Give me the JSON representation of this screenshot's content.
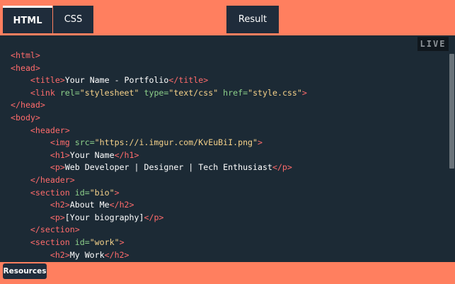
{
  "tabs": {
    "html": "HTML",
    "css": "CSS",
    "result": "Result"
  },
  "editor": {
    "live_badge": "LIVE",
    "lines": [
      [
        {
          "t": "tag",
          "v": "<html>"
        }
      ],
      [
        {
          "t": "tag",
          "v": "<head>"
        }
      ],
      [
        {
          "t": "txt",
          "v": "    "
        },
        {
          "t": "tag",
          "v": "<title>"
        },
        {
          "t": "txt",
          "v": "Your Name - Portfolio"
        },
        {
          "t": "tag",
          "v": "</title>"
        }
      ],
      [
        {
          "t": "txt",
          "v": "    "
        },
        {
          "t": "tag",
          "v": "<link "
        },
        {
          "t": "attr",
          "v": "rel="
        },
        {
          "t": "str",
          "v": "\"stylesheet\""
        },
        {
          "t": "attr",
          "v": " type="
        },
        {
          "t": "str",
          "v": "\"text/css\""
        },
        {
          "t": "attr",
          "v": " href="
        },
        {
          "t": "str",
          "v": "\"style.css\""
        },
        {
          "t": "tag",
          "v": ">"
        }
      ],
      [
        {
          "t": "tag",
          "v": "</head>"
        }
      ],
      [
        {
          "t": "tag",
          "v": "<body>"
        }
      ],
      [
        {
          "t": "txt",
          "v": "    "
        },
        {
          "t": "tag",
          "v": "<header>"
        }
      ],
      [
        {
          "t": "txt",
          "v": "        "
        },
        {
          "t": "tag",
          "v": "<img "
        },
        {
          "t": "attr",
          "v": "src="
        },
        {
          "t": "str",
          "v": "\"https://i.imgur.com/KvEuBiI.png\""
        },
        {
          "t": "tag",
          "v": ">"
        }
      ],
      [
        {
          "t": "txt",
          "v": "        "
        },
        {
          "t": "tag",
          "v": "<h1>"
        },
        {
          "t": "txt",
          "v": "Your Name"
        },
        {
          "t": "tag",
          "v": "</h1>"
        }
      ],
      [
        {
          "t": "txt",
          "v": "        "
        },
        {
          "t": "tag",
          "v": "<p>"
        },
        {
          "t": "txt",
          "v": "Web Developer | Designer | Tech Enthusiast"
        },
        {
          "t": "tag",
          "v": "</p>"
        }
      ],
      [
        {
          "t": "txt",
          "v": "    "
        },
        {
          "t": "tag",
          "v": "</header>"
        }
      ],
      [
        {
          "t": "txt",
          "v": "    "
        },
        {
          "t": "tag",
          "v": "<section "
        },
        {
          "t": "attr",
          "v": "id="
        },
        {
          "t": "str",
          "v": "\"bio\""
        },
        {
          "t": "tag",
          "v": ">"
        }
      ],
      [
        {
          "t": "txt",
          "v": "        "
        },
        {
          "t": "tag",
          "v": "<h2>"
        },
        {
          "t": "txt",
          "v": "About Me"
        },
        {
          "t": "tag",
          "v": "</h2>"
        }
      ],
      [
        {
          "t": "txt",
          "v": "        "
        },
        {
          "t": "tag",
          "v": "<p>"
        },
        {
          "t": "txt",
          "v": "[Your biography]"
        },
        {
          "t": "tag",
          "v": "</p>"
        }
      ],
      [
        {
          "t": "txt",
          "v": "    "
        },
        {
          "t": "tag",
          "v": "</section>"
        }
      ],
      [
        {
          "t": "txt",
          "v": "    "
        },
        {
          "t": "tag",
          "v": "<section "
        },
        {
          "t": "attr",
          "v": "id="
        },
        {
          "t": "str",
          "v": "\"work\""
        },
        {
          "t": "tag",
          "v": ">"
        }
      ],
      [
        {
          "t": "txt",
          "v": "        "
        },
        {
          "t": "tag",
          "v": "<h2>"
        },
        {
          "t": "txt",
          "v": "My Work"
        },
        {
          "t": "tag",
          "v": "</h2>"
        }
      ]
    ]
  },
  "bottom": {
    "resources_label": "Resources"
  },
  "colors": {
    "accent": "#ff7f5f",
    "tab_bg": "#1f2c3b",
    "editor_bg": "#1c2a35",
    "tag": "#ff6b6b",
    "attr": "#8dd08a",
    "string": "#f6d28a"
  }
}
